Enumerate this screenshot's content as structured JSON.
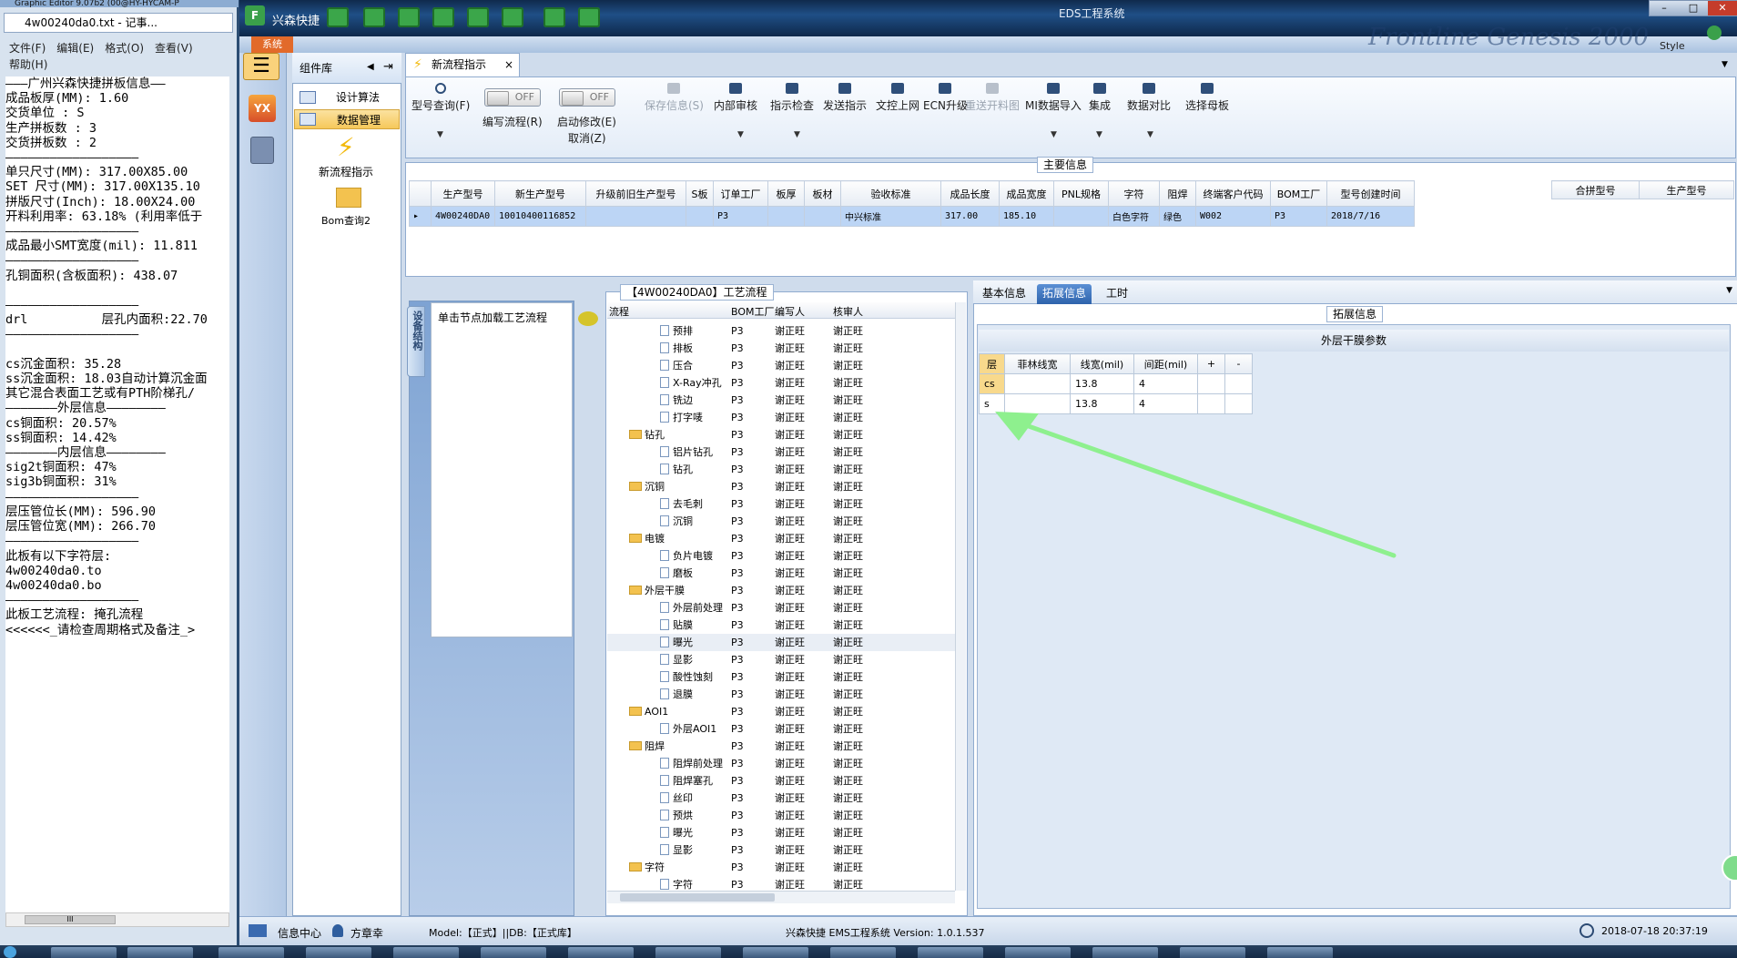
{
  "notepad": {
    "titlebar": "Graphic Editor 9.07b2 (00@HY-HYCAM-P",
    "tab_title": "4w00240da0.txt - 记事...",
    "menu": [
      "文件(F)",
      "编辑(E)",
      "格式(O)",
      "查看(V)",
      "帮助(H)"
    ],
    "text": "———广州兴森快捷拼板信息——\n成品板厚(MM): 1.60\n交货单位 : S\n生产拼板数 : 3\n交货拼板数 : 2\n——————————————————\n单只尺寸(MM): 317.00X85.00\nSET 尺寸(MM): 317.00X135.10\n拼版尺寸(Inch): 18.00X24.00\n开料利用率: 63.18% (利用率低于\n——————————————————\n成品最小SMT宽度(mil): 11.811\n——————————————————\n孔铜面积(含板面积): 438.07\n\n——————————————————\ndrl          层孔内面积:22.70\n——————————————————\n\ncs沉金面积: 35.28\nss沉金面积: 18.03自动计算沉金面\n其它混合表面工艺或有PTH阶梯孔/\n———————外层信息————————\ncs铜面积: 20.57%\nss铜面积: 14.42%\n———————内层信息————————\nsig2t铜面积: 47%\nsig3b铜面积: 31%\n——————————————————\n层压管位长(MM): 596.90\n层压管位宽(MM): 266.70\n——————————————————\n此板有以下字符层:\n4w00240da0.to\n4w00240da0.bo\n——————————————————\n此板工艺流程: 掩孔流程\n<<<<<<_请检查周期格式及备注_>",
    "hscroll_glyph": "III"
  },
  "app": {
    "title": "EDS工程系统",
    "brand": "兴森快捷",
    "system_tab": "系统",
    "style_label": "Style",
    "watermark": "Frontline Genesis 2000",
    "win_buttons": [
      "–",
      "□",
      "✕"
    ]
  },
  "component_panel": {
    "title": "组件库",
    "items": [
      "设计算法",
      "数据管理"
    ],
    "big_items": [
      "新流程指示",
      "Bom查询2"
    ]
  },
  "doc_tab": {
    "label": "新流程指示",
    "close": "×"
  },
  "toolbar": {
    "query": "型号查询(F)",
    "write_flow": "编写流程(R)",
    "auto_modify": "启动修改(E)",
    "cancel": "取消(Z)",
    "toggle_off": "OFF",
    "buttons": [
      "保存信息(S)",
      "内部审核",
      "指示检查",
      "发送指示",
      "文控上网",
      "ECN升级",
      "重送开料图",
      "MI数据导入",
      "集成",
      "数据对比",
      "选择母板"
    ],
    "disabled": [
      "保存信息(S)",
      "重送开料图"
    ]
  },
  "main_info": {
    "title": "主要信息",
    "columns": [
      "生产型号",
      "新生产型号",
      "升级前旧生产型号",
      "S板",
      "订单工厂",
      "板厚",
      "板材",
      "验收标准",
      "成品长度",
      "成品宽度",
      "PNL规格",
      "字符",
      "阻焊",
      "终端客户代码",
      "BOM工厂",
      "型号创建时间"
    ],
    "row": [
      "4W00240DA0",
      "10010400116852",
      "",
      "",
      "P3",
      "",
      "",
      "中兴标准",
      "317.00",
      "185.10",
      "",
      "白色字符",
      "绿色",
      "W002",
      "P3",
      "2018/7/16"
    ],
    "merge_columns": [
      "合拼型号",
      "生产型号"
    ]
  },
  "device_panel": {
    "side_tab": "设备结构",
    "hint": "单击节点加载工艺流程"
  },
  "process": {
    "title": "【4W00240DA0】工艺流程",
    "columns": [
      "流程",
      "BOM工厂",
      "编写人",
      "核审人"
    ],
    "rows": [
      {
        "name": "预排",
        "kind": "doc",
        "bom": "P3",
        "writer": "谢正旺",
        "reviewer": "谢正旺"
      },
      {
        "name": "排板",
        "kind": "doc",
        "bom": "P3",
        "writer": "谢正旺",
        "reviewer": "谢正旺"
      },
      {
        "name": "压合",
        "kind": "doc",
        "bom": "P3",
        "writer": "谢正旺",
        "reviewer": "谢正旺"
      },
      {
        "name": "X-Ray冲孔",
        "kind": "doc",
        "bom": "P3",
        "writer": "谢正旺",
        "reviewer": "谢正旺"
      },
      {
        "name": "铣边",
        "kind": "doc",
        "bom": "P3",
        "writer": "谢正旺",
        "reviewer": "谢正旺"
      },
      {
        "name": "打字唛",
        "kind": "doc",
        "bom": "P3",
        "writer": "谢正旺",
        "reviewer": "谢正旺"
      },
      {
        "name": "钻孔",
        "kind": "folder",
        "bom": "P3",
        "writer": "谢正旺",
        "reviewer": "谢正旺"
      },
      {
        "name": "铝片钻孔",
        "kind": "doc",
        "bom": "P3",
        "writer": "谢正旺",
        "reviewer": "谢正旺"
      },
      {
        "name": "钻孔",
        "kind": "doc",
        "bom": "P3",
        "writer": "谢正旺",
        "reviewer": "谢正旺"
      },
      {
        "name": "沉铜",
        "kind": "folder",
        "bom": "P3",
        "writer": "谢正旺",
        "reviewer": "谢正旺"
      },
      {
        "name": "去毛刺",
        "kind": "doc",
        "bom": "P3",
        "writer": "谢正旺",
        "reviewer": "谢正旺"
      },
      {
        "name": "沉铜",
        "kind": "doc",
        "bom": "P3",
        "writer": "谢正旺",
        "reviewer": "谢正旺"
      },
      {
        "name": "电镀",
        "kind": "folder",
        "bom": "P3",
        "writer": "谢正旺",
        "reviewer": "谢正旺"
      },
      {
        "name": "负片电镀",
        "kind": "doc",
        "bom": "P3",
        "writer": "谢正旺",
        "reviewer": "谢正旺"
      },
      {
        "name": "磨板",
        "kind": "doc",
        "bom": "P3",
        "writer": "谢正旺",
        "reviewer": "谢正旺"
      },
      {
        "name": "外层干膜",
        "kind": "folder",
        "bom": "P3",
        "writer": "谢正旺",
        "reviewer": "谢正旺"
      },
      {
        "name": "外层前处理",
        "kind": "doc",
        "bom": "P3",
        "writer": "谢正旺",
        "reviewer": "谢正旺"
      },
      {
        "name": "贴膜",
        "kind": "doc",
        "bom": "P3",
        "writer": "谢正旺",
        "reviewer": "谢正旺"
      },
      {
        "name": "曝光",
        "kind": "doc",
        "bom": "P3",
        "writer": "谢正旺",
        "reviewer": "谢正旺"
      },
      {
        "name": "显影",
        "kind": "doc",
        "bom": "P3",
        "writer": "谢正旺",
        "reviewer": "谢正旺"
      },
      {
        "name": "酸性蚀刻",
        "kind": "doc",
        "bom": "P3",
        "writer": "谢正旺",
        "reviewer": "谢正旺"
      },
      {
        "name": "退膜",
        "kind": "doc",
        "bom": "P3",
        "writer": "谢正旺",
        "reviewer": "谢正旺"
      },
      {
        "name": "AOI1",
        "kind": "folder",
        "bom": "P3",
        "writer": "谢正旺",
        "reviewer": "谢正旺"
      },
      {
        "name": "外层AOI1",
        "kind": "doc",
        "bom": "P3",
        "writer": "谢正旺",
        "reviewer": "谢正旺"
      },
      {
        "name": "阻焊",
        "kind": "folder",
        "bom": "P3",
        "writer": "谢正旺",
        "reviewer": "谢正旺"
      },
      {
        "name": "阻焊前处理",
        "kind": "doc",
        "bom": "P3",
        "writer": "谢正旺",
        "reviewer": "谢正旺"
      },
      {
        "name": "阻焊塞孔",
        "kind": "doc",
        "bom": "P3",
        "writer": "谢正旺",
        "reviewer": "谢正旺"
      },
      {
        "name": "丝印",
        "kind": "doc",
        "bom": "P3",
        "writer": "谢正旺",
        "reviewer": "谢正旺"
      },
      {
        "name": "预烘",
        "kind": "doc",
        "bom": "P3",
        "writer": "谢正旺",
        "reviewer": "谢正旺"
      },
      {
        "name": "曝光",
        "kind": "doc",
        "bom": "P3",
        "writer": "谢正旺",
        "reviewer": "谢正旺"
      },
      {
        "name": "显影",
        "kind": "doc",
        "bom": "P3",
        "writer": "谢正旺",
        "reviewer": "谢正旺"
      },
      {
        "name": "字符",
        "kind": "folder",
        "bom": "P3",
        "writer": "谢正旺",
        "reviewer": "谢正旺"
      },
      {
        "name": "字符",
        "kind": "doc",
        "bom": "P3",
        "writer": "谢正旺",
        "reviewer": "谢正旺"
      }
    ]
  },
  "ext_panel": {
    "tabs": [
      "基本信息",
      "拓展信息",
      "工时"
    ],
    "active_tab": "拓展信息",
    "section_title": "拓展信息",
    "outer_title": "外层干膜参数",
    "columns": [
      "层",
      "菲林线宽",
      "线宽(mil)",
      "间距(mil)",
      "+",
      "-"
    ],
    "rows": [
      {
        "layer": "cs",
        "film": "",
        "width": "13.8",
        "space": "4"
      },
      {
        "layer": "s",
        "film": "",
        "width": "13.8",
        "space": "4"
      }
    ]
  },
  "status": {
    "info_center": "信息中心",
    "user": "方章幸",
    "model": "Model:【正式】||DB:【正式库】",
    "version": "兴森快捷 EMS工程系统 Version: 1.0.1.537",
    "datetime": "2018-07-18 20:37:19"
  },
  "colors": {
    "accent_orange": "#e26a2a",
    "selected_blue": "#2e63ac",
    "row_highlight": "#bcd5f5",
    "annotation_arrow": "#8ef08e"
  }
}
